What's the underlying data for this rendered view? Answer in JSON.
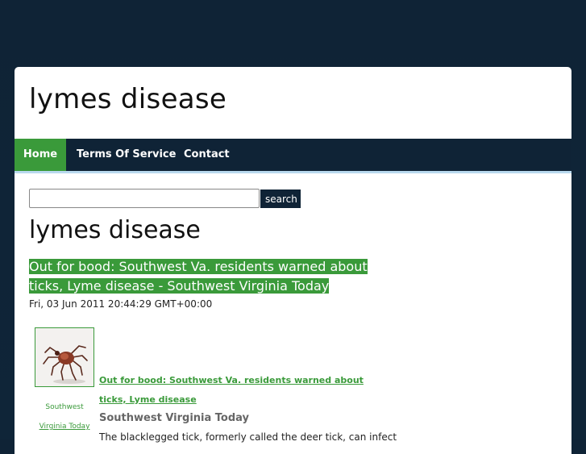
{
  "site": {
    "title": "lymes disease"
  },
  "nav": {
    "items": [
      {
        "label": "Home"
      },
      {
        "label": "Terms Of Service"
      },
      {
        "label": "Contact"
      }
    ]
  },
  "search": {
    "value": "",
    "button_label": "search"
  },
  "main": {
    "heading": "lymes disease",
    "article": {
      "title": "Out for bood: Southwest Va. residents warned about ticks, Lyme disease - Southwest Virginia Today",
      "date": "Fri, 03 Jun 2011 20:44:29 GMT+00:00",
      "thumb_caption_line1": "Southwest",
      "thumb_caption_line2": "Virginia Today",
      "link_text": "Out for bood: Southwest Va. residents warned about ticks, Lyme disease",
      "source": "Southwest Virginia Today",
      "snippet": "The blacklegged tick, formerly called the deer tick, can infect"
    }
  },
  "colors": {
    "accent": "#3a9a3a",
    "nav_bg": "#0f2336",
    "page_bg": "#0f2336"
  },
  "icons": {
    "thumbnail": "tick-image"
  }
}
